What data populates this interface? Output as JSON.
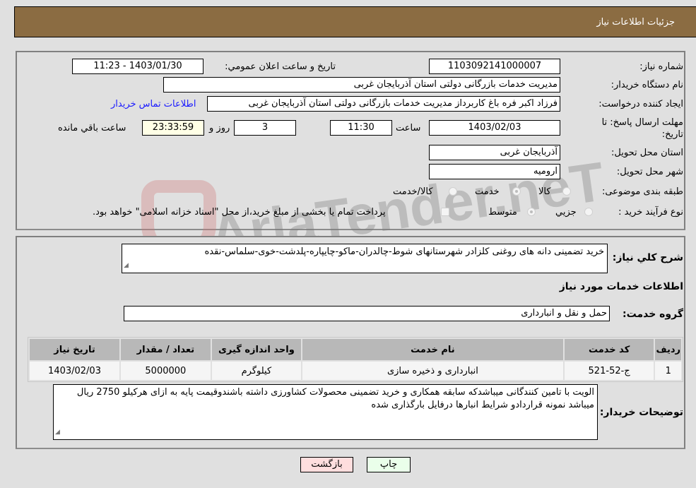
{
  "header": {
    "title": "جزئیات اطلاعات نیاز"
  },
  "watermark": {
    "text": "AriaTender.neT"
  },
  "details": {
    "need_number": {
      "label": "شماره نیاز:",
      "value": "1103092141000007"
    },
    "announce_datetime": {
      "label": "تاريخ و ساعت اعلان عمومي:",
      "value": "1403/01/30 - 11:23"
    },
    "buyer_org": {
      "label": "نام دستگاه خریدار:",
      "value": "مدیریت خدمات بازرگانی دولتی استان آذربایجان غربی"
    },
    "requester": {
      "label": "ایجاد کننده درخواست:",
      "value": "فرزاد اکبر فره باغ کاربرداز مدیریت خدمات بازرگانی دولتی استان آذربایجان غربی",
      "contact_link": "اطلاعات تماس خریدار"
    },
    "deadline": {
      "label": "مهلت ارسال پاسخ: تا تاریخ:",
      "date": "1403/02/03",
      "time_label": "ساعت",
      "time": "11:30",
      "days": "3",
      "days_label": "روز و",
      "remaining": "23:33:59",
      "remaining_label": "ساعت باقي مانده"
    },
    "delivery_province": {
      "label": "استان محل تحویل:",
      "value": "آذربایجان غربی"
    },
    "delivery_city": {
      "label": "شهر محل تحویل:",
      "value": "ارومیه"
    },
    "category": {
      "label": "طبقه بندی موضوعی:",
      "options": [
        {
          "label": "کالا",
          "checked": false
        },
        {
          "label": "خدمت",
          "checked": true
        },
        {
          "label": "کالا/خدمت",
          "checked": false
        }
      ]
    },
    "purchase_type": {
      "label": "نوع فرآیند خرید :",
      "options": [
        {
          "label": "جزيي",
          "checked": false
        },
        {
          "label": "متوسط",
          "checked": true
        }
      ],
      "treasury_note": "پرداخت تمام یا بخشی از مبلغ خرید،از محل \"اسناد خزانه اسلامی\" خواهد بود."
    }
  },
  "summary": {
    "label": "شرح كلي نياز:",
    "value": "خرید تضمینی دانه های روغنی کلزادر شهرستانهای شوط-چالدران-ماکو-چایپاره-پلدشت-خوی-سلماس-نقده"
  },
  "services": {
    "section_title": "اطلاعات خدمات مورد نیاز",
    "group_label": "گروه خدمت:",
    "group_value": "حمل و نقل و انبارداری",
    "table": {
      "headers": [
        "ردیف",
        "کد خدمت",
        "نام خدمت",
        "واحد اندازه گیری",
        "تعداد / مقدار",
        "تاریخ نیاز"
      ],
      "rows": [
        [
          "1",
          "ج-52-521",
          "انبارداری و ذخیره سازی",
          "کیلوگرم",
          "5000000",
          "1403/02/03"
        ]
      ]
    }
  },
  "buyer_notes": {
    "label": "توضیحات خریدار:",
    "value": "الویت با تامین کنندگانی میباشدکه سابقه همکاری و خرید تضمینی محصولات کشاورزی داشته باشندوقیمت پایه به ازای هرکیلو 2750 ریال میباشد نمونه قراردادو شرایط انبارها درفایل بارگذاری شده"
  },
  "buttons": {
    "print": "چاپ",
    "back": "بازگشت"
  },
  "colors": {
    "header_bg": "#8b6c42",
    "print_bg": "#eaffea",
    "back_bg": "#ffdede",
    "link": "#1a1aff"
  }
}
